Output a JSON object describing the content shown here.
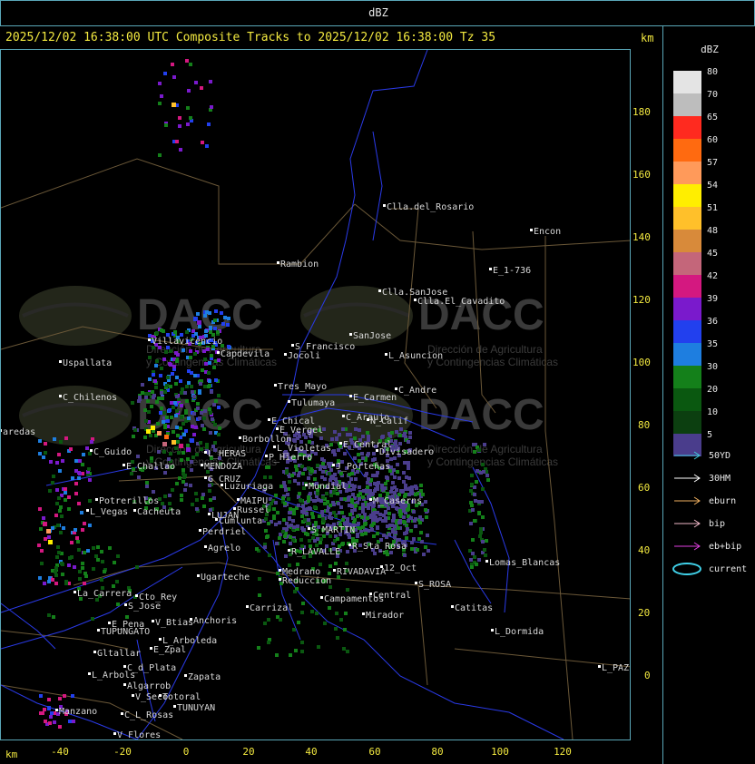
{
  "window": {
    "title": "dBZ"
  },
  "header": {
    "text": "2025/12/02 16:38:00 UTC Composite Tracks to 2025/12/02 16:38:00 Tz 35",
    "units": "km"
  },
  "axes": {
    "y_ticks": [
      "180",
      "160",
      "140",
      "120",
      "100",
      "80",
      "60",
      "40",
      "20",
      "0"
    ],
    "x_ticks": [
      "-40",
      "-20",
      "0",
      "20",
      "40",
      "60",
      "80",
      "100",
      "120"
    ],
    "x_units": "km"
  },
  "legend": {
    "title": "dBZ",
    "scale": [
      {
        "label": "80",
        "color": "#e4e4e4"
      },
      {
        "label": "70",
        "color": "#bdbdbd"
      },
      {
        "label": "65",
        "color": "#ff2a1f"
      },
      {
        "label": "60",
        "color": "#ff6a10"
      },
      {
        "label": "57",
        "color": "#ff9a5a"
      },
      {
        "label": "54",
        "color": "#ffee00"
      },
      {
        "label": "51",
        "color": "#ffc02a"
      },
      {
        "label": "48",
        "color": "#d88a3a"
      },
      {
        "label": "45",
        "color": "#c4667a"
      },
      {
        "label": "42",
        "color": "#d41880"
      },
      {
        "label": "39",
        "color": "#7a1acc"
      },
      {
        "label": "36",
        "color": "#2240ee"
      },
      {
        "label": "35",
        "color": "#1e7ee0"
      },
      {
        "label": "30",
        "color": "#14801a"
      },
      {
        "label": "20",
        "color": "#0a5810"
      },
      {
        "label": "10",
        "color": "#1a1a20"
      },
      {
        "label": "5",
        "color": "#4a3d8c"
      }
    ],
    "tracks": [
      {
        "label": "50YD",
        "color": "#40c8d8"
      },
      {
        "label": "30HM",
        "color": "#ffffff"
      },
      {
        "label": "eburn",
        "color": "#f0b060"
      },
      {
        "label": "bip",
        "color": "#f0b8c8"
      },
      {
        "label": "eb+bip",
        "color": "#e040e0"
      },
      {
        "label": "current",
        "color": "#40d0e8"
      }
    ]
  },
  "watermark": {
    "brand": "DACC",
    "subtitle_line1": "Dirección de Agricultura",
    "subtitle_line2": "y Contingencias Climáticas"
  },
  "places": [
    {
      "name": "Clla.del_Rosario"
    },
    {
      "name": "Encon"
    },
    {
      "name": "E_1-736"
    },
    {
      "name": "Rambion"
    },
    {
      "name": "Clla.SanJose"
    },
    {
      "name": "Clla.El_Cavadito"
    },
    {
      "name": "Villavicencio"
    },
    {
      "name": "S_Francisco"
    },
    {
      "name": "SanJose"
    },
    {
      "name": "Capdevila"
    },
    {
      "name": "Jocoli"
    },
    {
      "name": "L_Asuncion"
    },
    {
      "name": "Uspallata"
    },
    {
      "name": "Tres_Mayo"
    },
    {
      "name": "C_Andre"
    },
    {
      "name": "C_Chilenos"
    },
    {
      "name": "Tulumaya"
    },
    {
      "name": "E_Carmen"
    },
    {
      "name": "C_Araujo"
    },
    {
      "name": "E_Chical"
    },
    {
      "name": "N_Calif"
    },
    {
      "name": "E_Vergel"
    },
    {
      "name": "aredas"
    },
    {
      "name": "Borbollon"
    },
    {
      "name": "E_Central"
    },
    {
      "name": "L_Violetas"
    },
    {
      "name": "Divisadero"
    },
    {
      "name": "C_Guido"
    },
    {
      "name": "L_HERAS"
    },
    {
      "name": "P_Hierro"
    },
    {
      "name": "E_Challao"
    },
    {
      "name": "MENDOZA"
    },
    {
      "name": "J_Porteñas"
    },
    {
      "name": "G_CRUZ"
    },
    {
      "name": "Luzuriaga"
    },
    {
      "name": "Mundial"
    },
    {
      "name": "M_Caserns"
    },
    {
      "name": "Potrerillos"
    },
    {
      "name": "MAIPU"
    },
    {
      "name": "Russel"
    },
    {
      "name": "L_Vegas"
    },
    {
      "name": "Cacheuta"
    },
    {
      "name": "LUJAN"
    },
    {
      "name": "Cumlunta"
    },
    {
      "name": "S_MARTIN"
    },
    {
      "name": "Perdriel"
    },
    {
      "name": "Agrelo"
    },
    {
      "name": "R_LAVALLE"
    },
    {
      "name": "R_Sta_Rosa"
    },
    {
      "name": "Lomas_Blancas"
    },
    {
      "name": "Ugarteche"
    },
    {
      "name": "Medrano"
    },
    {
      "name": "12_Oct"
    },
    {
      "name": "Reduccion"
    },
    {
      "name": "RIVADAVIA"
    },
    {
      "name": "S_ROSA"
    },
    {
      "name": "La_Carrera"
    },
    {
      "name": "Cto_Rey"
    },
    {
      "name": "S_Jose"
    },
    {
      "name": "Campamentos"
    },
    {
      "name": "Central"
    },
    {
      "name": "Catitas"
    },
    {
      "name": "Carrizal"
    },
    {
      "name": "Anchoris"
    },
    {
      "name": "E_Pena"
    },
    {
      "name": "V_Btias"
    },
    {
      "name": "TUPUNGATO"
    },
    {
      "name": "Mirador"
    },
    {
      "name": "L_Dormida"
    },
    {
      "name": "L_Arboleda"
    },
    {
      "name": "E_Zpal"
    },
    {
      "name": "Gltallar"
    },
    {
      "name": "C_d_Plata"
    },
    {
      "name": "L_Arbols"
    },
    {
      "name": "Zapata"
    },
    {
      "name": "L_PAZ"
    },
    {
      "name": "Algarrob"
    },
    {
      "name": "V_Seco"
    },
    {
      "name": "Totoral"
    },
    {
      "name": "TUNUYAN"
    },
    {
      "name": "Manzano"
    },
    {
      "name": "C_L_Rosas"
    },
    {
      "name": "V_Flores"
    }
  ]
}
